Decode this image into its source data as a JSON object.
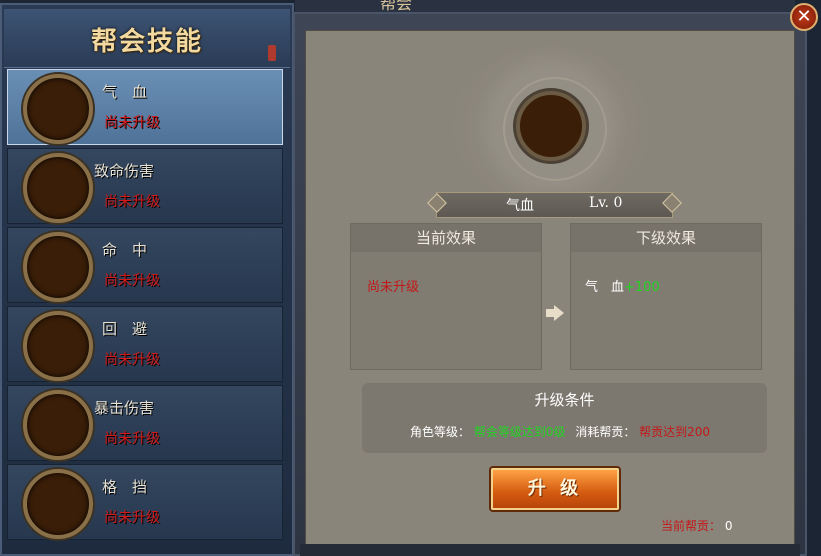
{
  "left_panel": {
    "title": "帮会技能",
    "skills": [
      {
        "name": "气　血",
        "status": "尚未升级"
      },
      {
        "name": "致命伤害",
        "status": "尚未升级"
      },
      {
        "name": "命　中",
        "status": "尚未升级"
      },
      {
        "name": "回　避",
        "status": "尚未升级"
      },
      {
        "name": "暴击伤害",
        "status": "尚未升级"
      },
      {
        "name": "格　挡",
        "status": "尚未升级"
      }
    ]
  },
  "top_partial_title": "帮会",
  "detail": {
    "skill_name": "气血",
    "level": "Lv. 0",
    "current_effect_header": "当前效果",
    "current_effect_value": "尚未升级",
    "next_effect_header": "下级效果",
    "next_effect_stat": "气　血",
    "next_effect_bonus": "+100",
    "condition_title": "升级条件",
    "cond_role_label": "角色等级：",
    "cond_role_value": "帮会等级达到0级",
    "cond_cost_label": "消耗帮贡：",
    "cond_cost_value": "帮贡达到200",
    "upgrade_button": "升 级",
    "contribution_label": "当前帮贡：",
    "contribution_value": "0"
  },
  "close_label": "✕",
  "colors": {
    "accent_orange": "#d35a10",
    "status_red": "#c31818",
    "bonus_green": "#22d322",
    "title_gold": "#f2d9a0"
  }
}
